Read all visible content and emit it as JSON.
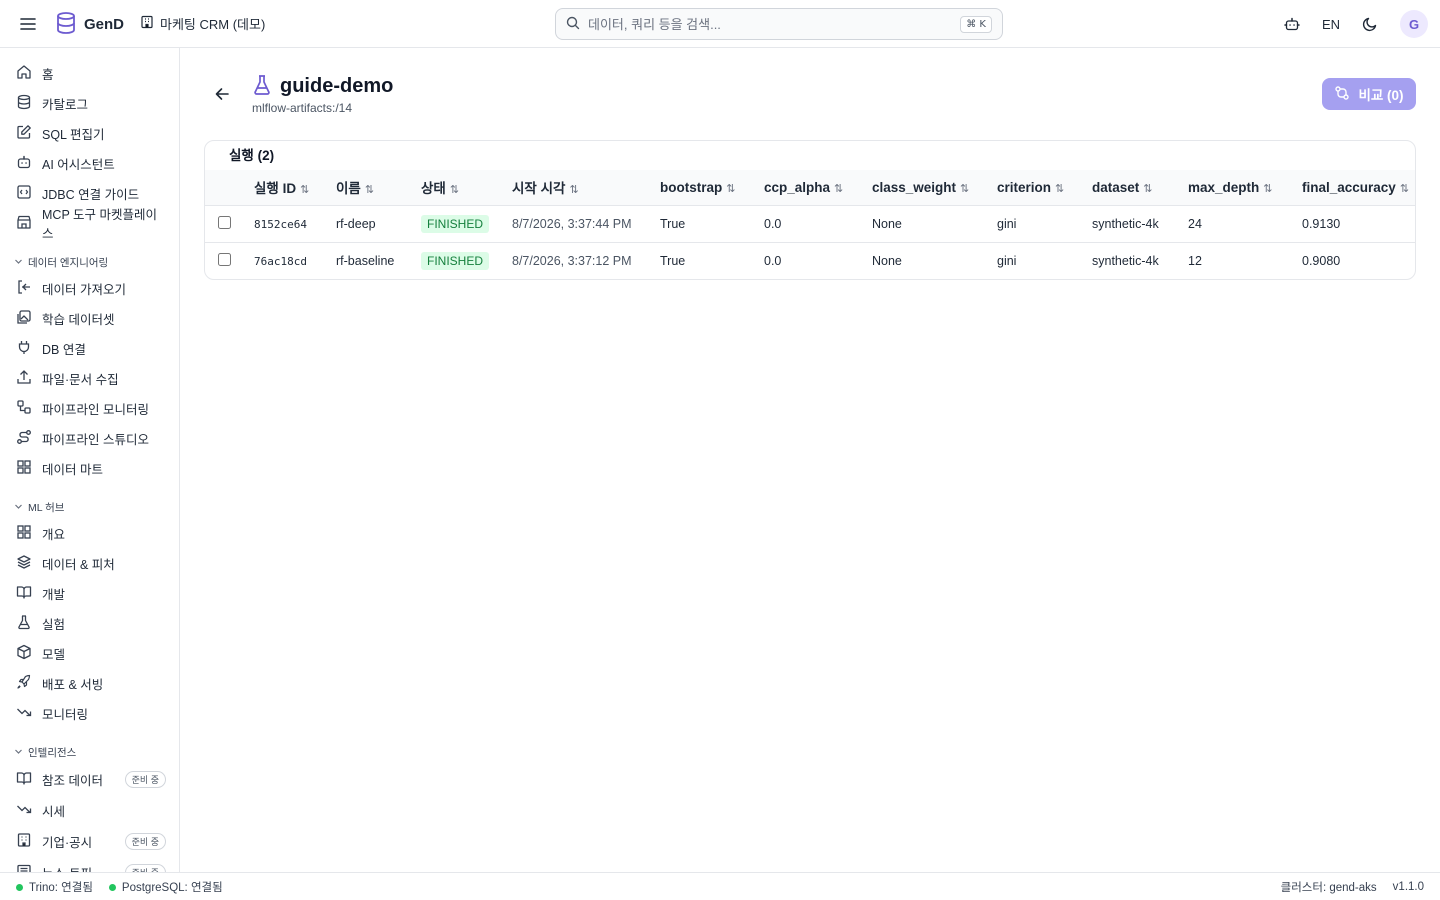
{
  "topbar": {
    "brand": "GenD",
    "workspace": "마케팅 CRM (데모)",
    "search_placeholder": "데이터, 쿼리 등을 검색...",
    "search_kbd": "⌘ K",
    "lang": "EN",
    "avatar_initial": "G"
  },
  "sidebar": {
    "main_items": [
      {
        "label": "홈",
        "icon": "home-icon"
      },
      {
        "label": "카탈로그",
        "icon": "database-icon"
      },
      {
        "label": "SQL 편집기",
        "icon": "edit-icon"
      },
      {
        "label": "AI 어시스턴트",
        "icon": "bot-icon"
      },
      {
        "label": "JDBC 연결 가이드",
        "icon": "code-icon"
      },
      {
        "label": "MCP 도구 마켓플레이스",
        "icon": "store-icon"
      }
    ],
    "sections": [
      {
        "title": "데이터 엔지니어링",
        "items": [
          {
            "label": "데이터 가져오기",
            "icon": "import-icon"
          },
          {
            "label": "학습 데이터셋",
            "icon": "images-icon"
          },
          {
            "label": "DB 연결",
            "icon": "plug-icon"
          },
          {
            "label": "파일·문서 수집",
            "icon": "upload-icon"
          },
          {
            "label": "파이프라인 모니터링",
            "icon": "workflow-icon"
          },
          {
            "label": "파이프라인 스튜디오",
            "icon": "route-icon"
          },
          {
            "label": "데이터 마트",
            "icon": "grid-icon"
          }
        ]
      },
      {
        "title": "ML 허브",
        "items": [
          {
            "label": "개요",
            "icon": "grid-icon"
          },
          {
            "label": "데이터 & 피처",
            "icon": "layers-icon"
          },
          {
            "label": "개발",
            "icon": "book-icon"
          },
          {
            "label": "실험",
            "icon": "flask-icon"
          },
          {
            "label": "모델",
            "icon": "box-icon"
          },
          {
            "label": "배포 & 서빙",
            "icon": "rocket-icon"
          },
          {
            "label": "모니터링",
            "icon": "trend-down-icon"
          }
        ]
      },
      {
        "title": "인텔리전스",
        "items": [
          {
            "label": "참조 데이터",
            "icon": "book-icon",
            "badge": "준비 중"
          },
          {
            "label": "시세",
            "icon": "trend-down-icon"
          },
          {
            "label": "기업·공시",
            "icon": "building-icon",
            "badge": "준비 중"
          },
          {
            "label": "뉴스·토픽",
            "icon": "news-icon",
            "badge": "준비 중"
          }
        ]
      }
    ]
  },
  "experiment": {
    "name": "guide-demo",
    "path": "mlflow-artifacts:/14",
    "compare_label": "비교 (0)",
    "runs_title": "실행 (2)"
  },
  "table": {
    "columns": [
      "실행 ID",
      "이름",
      "상태",
      "시작 시각",
      "bootstrap",
      "ccp_alpha",
      "class_weight",
      "criterion",
      "dataset",
      "max_depth",
      "final_accuracy"
    ],
    "rows": [
      [
        "8152ce64",
        "rf-deep",
        "FINISHED",
        "8/7/2026, 3:37:44 PM",
        "True",
        "0.0",
        "None",
        "gini",
        "synthetic-4k",
        "24",
        "0.9130"
      ],
      [
        "76ac18cd",
        "rf-baseline",
        "FINISHED",
        "8/7/2026, 3:37:12 PM",
        "True",
        "0.0",
        "None",
        "gini",
        "synthetic-4k",
        "12",
        "0.9080"
      ]
    ]
  },
  "footer": {
    "trino": "Trino: 연결됨",
    "postgres": "PostgreSQL: 연결됨",
    "cluster": "클러스터: gend-aks",
    "version": "v1.1.0"
  },
  "colors": {
    "accent": "#6d5bd0",
    "compare_bg": "#a5a0f0",
    "status_bg": "#dcfce7",
    "status_fg": "#15803d",
    "connected_dot": "#22c55e"
  }
}
